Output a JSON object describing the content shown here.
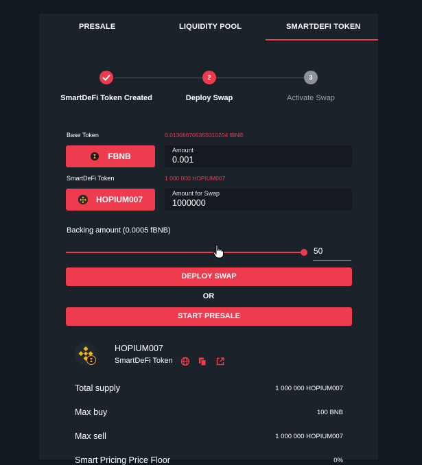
{
  "tabs": [
    {
      "label": "PRESALE"
    },
    {
      "label": "LIQUIDITY POOL"
    },
    {
      "label": "SMARTDEFI TOKEN"
    }
  ],
  "active_tab": "SMARTDEFI TOKEN",
  "steps": [
    {
      "number": "",
      "label": "SmartDeFi Token Created",
      "status": "completed"
    },
    {
      "number": "2",
      "label": "Deploy Swap",
      "status": "current"
    },
    {
      "number": "3",
      "label": "Activate Swap",
      "status": "pending"
    }
  ],
  "base_token": {
    "label": "Base Token",
    "balance": "0.013086705355010204 fBNB",
    "token_name": "FBNB",
    "amount_label": "Amount",
    "amount_value": "0.001"
  },
  "smartdefi_token": {
    "label": "SmartDeFi Token",
    "balance": "1 000 000 HOPIUM007",
    "token_name": "HOPIUM007",
    "amount_label": "Amount for Swap",
    "amount_value": "1000000"
  },
  "backing": {
    "label": "Backing amount (0.0005 fBNB)",
    "slider_value": "50",
    "slider_fraction": 1.0
  },
  "buttons": {
    "deploy_swap": "DEPLOY SWAP",
    "or": "OR",
    "start_presale": "START PRESALE"
  },
  "token_info": {
    "name": "HOPIUM007",
    "type": "SmartDeFi Token",
    "icons": [
      "globe-icon",
      "copy-icon",
      "external-link-icon"
    ]
  },
  "stats": [
    {
      "label": "Total supply",
      "value": "1 000 000 HOPIUM007"
    },
    {
      "label": "Max buy",
      "value": "100 BNB"
    },
    {
      "label": "Max sell",
      "value": "1 000 000 HOPIUM007"
    },
    {
      "label": "Smart Pricing Price Floor",
      "value": "0%"
    }
  ],
  "colors": {
    "accent": "#ee3b4e",
    "panel": "#1b2229",
    "background": "#101820",
    "input": "#141a20",
    "pending_step": "#9aa0a6"
  }
}
